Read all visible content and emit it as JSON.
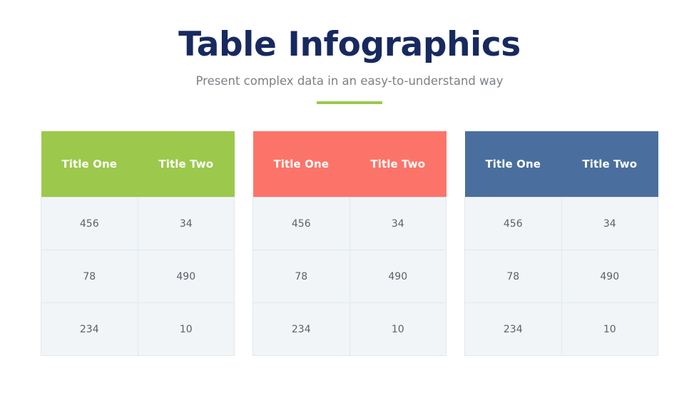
{
  "header": {
    "title": "Table Infographics",
    "subtitle": "Present complex data in an easy-to-understand way",
    "accent_color": "#9cc84c",
    "title_color": "#17295f",
    "subtitle_color": "#7c8186"
  },
  "theme": {
    "background": "#ffffff",
    "cell_background": "#f1f5f8",
    "cell_border": "#e2e8ec",
    "cell_text": "#5b6166",
    "header_text": "#ffffff"
  },
  "tables": [
    {
      "name": "green-table",
      "header_color": "#9cc84c",
      "columns": [
        "Title One",
        "Title Two"
      ],
      "rows": [
        [
          "456",
          "34"
        ],
        [
          "78",
          "490"
        ],
        [
          "234",
          "10"
        ]
      ]
    },
    {
      "name": "coral-table",
      "header_color": "#fc7469",
      "columns": [
        "Title One",
        "Title Two"
      ],
      "rows": [
        [
          "456",
          "34"
        ],
        [
          "78",
          "490"
        ],
        [
          "234",
          "10"
        ]
      ]
    },
    {
      "name": "blue-table",
      "header_color": "#4a6f9e",
      "columns": [
        "Title One",
        "Title Two"
      ],
      "rows": [
        [
          "456",
          "34"
        ],
        [
          "78",
          "490"
        ],
        [
          "234",
          "10"
        ]
      ]
    }
  ]
}
